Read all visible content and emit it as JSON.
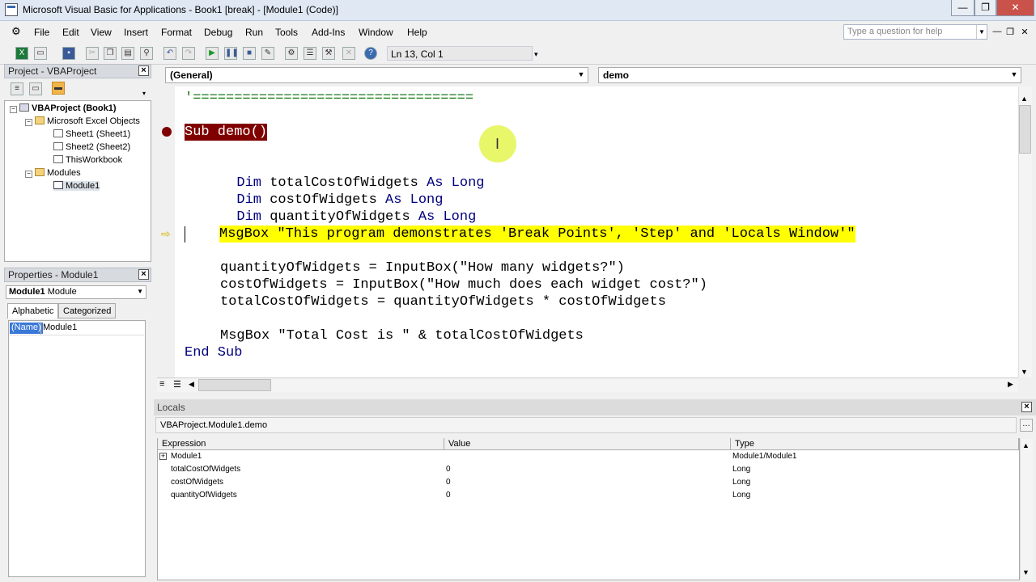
{
  "window": {
    "title": "Microsoft Visual Basic for Applications - Book1 [break] - [Module1 (Code)]",
    "controls": [
      "—",
      "❐",
      "✕"
    ],
    "doc_controls": [
      "—",
      "❐",
      "✕"
    ]
  },
  "menu": {
    "items": [
      "File",
      "Edit",
      "View",
      "Insert",
      "Format",
      "Debug",
      "Run",
      "Tools",
      "Add-Ins",
      "Window",
      "Help"
    ],
    "help_placeholder": "Type a question for help"
  },
  "toolbar": {
    "position": "Ln 13, Col 1"
  },
  "project_pane": {
    "title": "Project - VBAProject",
    "tree": {
      "root": "VBAProject (Book1)",
      "excel_objects": "Microsoft Excel Objects",
      "sheet1": "Sheet1 (Sheet1)",
      "sheet2": "Sheet2 (Sheet2)",
      "workbook": "ThisWorkbook",
      "modules": "Modules",
      "module1": "Module1"
    }
  },
  "properties_pane": {
    "title": "Properties - Module1",
    "object_name": "Module1",
    "object_type": "Module",
    "tabs": [
      "Alphabetic",
      "Categorized"
    ],
    "prop_name": "(Name)",
    "prop_value": "Module1"
  },
  "code": {
    "general_combo": "(General)",
    "proc_combo": "demo",
    "lines": {
      "l0": "'==================================",
      "l1_sub": "Sub demo()",
      "l2_dim": "Dim",
      "l2_name": " totalCostOfWidgets ",
      "l2_as": "As Long",
      "l3_dim": "Dim",
      "l3_name": " costOfWidgets ",
      "l3_as": "As Long",
      "l4_dim": "Dim",
      "l4_name": " quantityOfWidgets ",
      "l4_as": "As Long",
      "l5": "MsgBox \"This program demonstrates 'Break Points', 'Step' and 'Locals Window'\"",
      "l6": "quantityOfWidgets = InputBox(\"How many widgets?\")",
      "l7": "costOfWidgets = InputBox(\"How much does each widget cost?\")",
      "l8": "totalCostOfWidgets = quantityOfWidgets * costOfWidgets",
      "l9": "MsgBox \"Total Cost is \" & totalCostOfWidgets",
      "l10": "End Sub"
    }
  },
  "locals": {
    "title": "Locals",
    "context": "VBAProject.Module1.demo",
    "headers": [
      "Expression",
      "Value",
      "Type"
    ],
    "rows": [
      {
        "expr": "Module1",
        "value": "",
        "type": "Module1/Module1"
      },
      {
        "expr": "totalCostOfWidgets",
        "value": "0",
        "type": "Long"
      },
      {
        "expr": "costOfWidgets",
        "value": "0",
        "type": "Long"
      },
      {
        "expr": "quantityOfWidgets",
        "value": "0",
        "type": "Long"
      }
    ]
  },
  "colors": {
    "keyword": "#00007f",
    "breakpoint": "#800000",
    "execution_highlight": "#ffff00"
  }
}
